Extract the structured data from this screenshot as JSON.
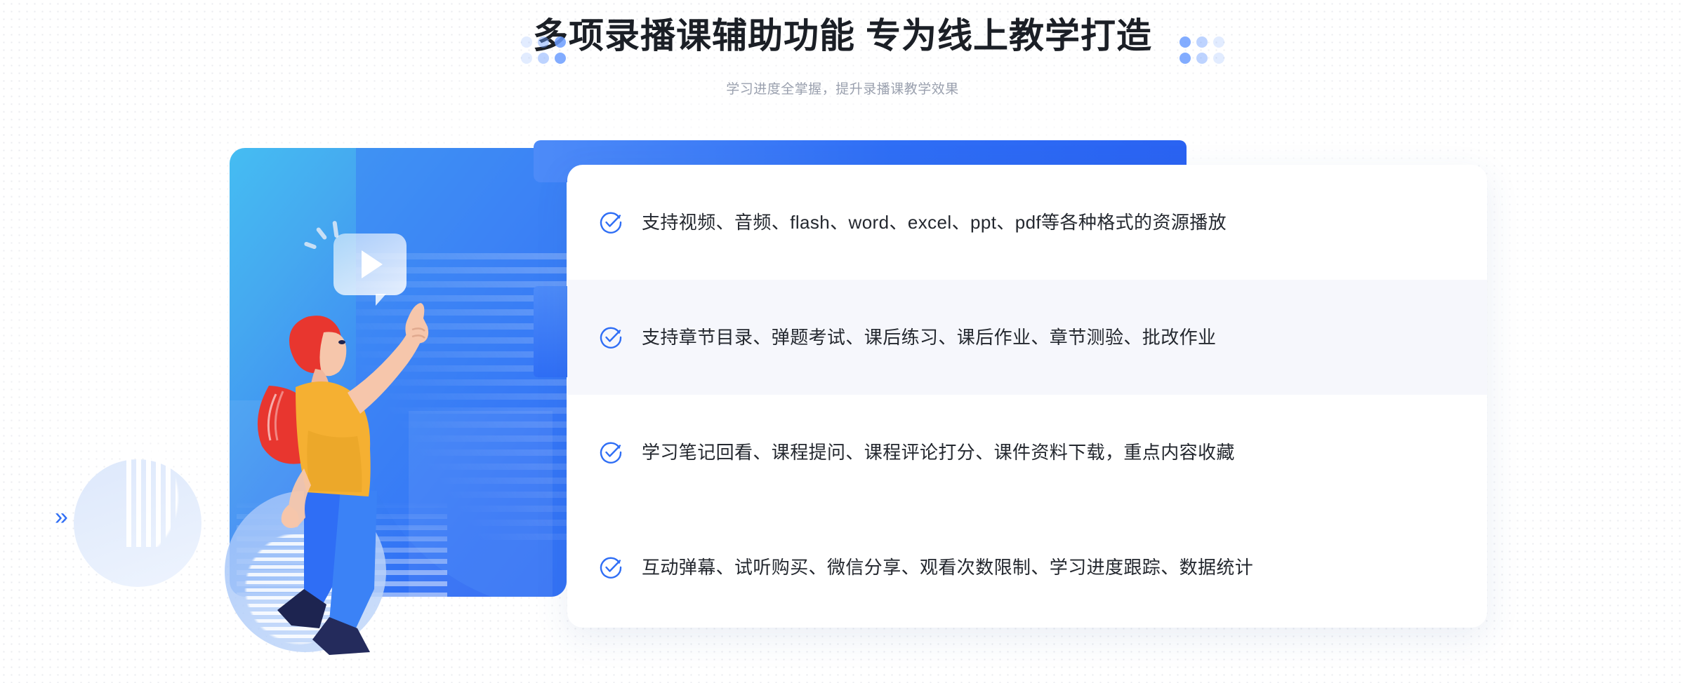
{
  "header": {
    "title": "多项录播课辅助功能 专为线上教学打造",
    "subtitle": "学习进度全掌握，提升录播课教学效果"
  },
  "colors": {
    "accent_blue": "#2f6ef5",
    "accent_light": "#4d8bf8",
    "cyan": "#45bdf2",
    "check_blue": "#2f6ef5",
    "title_text": "#1b1f26",
    "subtitle_text": "#9aa0ae",
    "body_text": "#24282f",
    "highlight_row_bg": "#f6f7fc",
    "card_bg": "#ffffff",
    "page_bg": "#ffffff",
    "dot_grid": "#d8dbe2",
    "shirt_yellow": "#f5b032",
    "hair_red": "#e8362f",
    "pants_blue": "#2f6ef5",
    "shoe_navy": "#1d2450"
  },
  "features": [
    {
      "icon": "check-circle-icon",
      "text": "支持视频、音频、flash、word、excel、ppt、pdf等各种格式的资源播放",
      "highlighted": false
    },
    {
      "icon": "check-circle-icon",
      "text": "支持章节目录、弹题考试、课后练习、课后作业、章节测验、批改作业",
      "highlighted": true
    },
    {
      "icon": "check-circle-icon",
      "text": "学习笔记回看、课程提问、课程评论打分、课件资料下载，重点内容收藏",
      "highlighted": false
    },
    {
      "icon": "check-circle-icon",
      "text": "互动弹幕、试听购买、微信分享、观看次数限制、学习进度跟踪、数据统计",
      "highlighted": false
    }
  ],
  "illustration": {
    "name": "woman-pointing-at-video-play-bubble",
    "play_icon": "play-triangle-icon",
    "bubble": "video-speech-bubble"
  },
  "decorations": {
    "dots_left": "dot-cluster-left",
    "dots_right": "dot-cluster-right",
    "chevron_right": "»",
    "chevron_left": "«"
  }
}
